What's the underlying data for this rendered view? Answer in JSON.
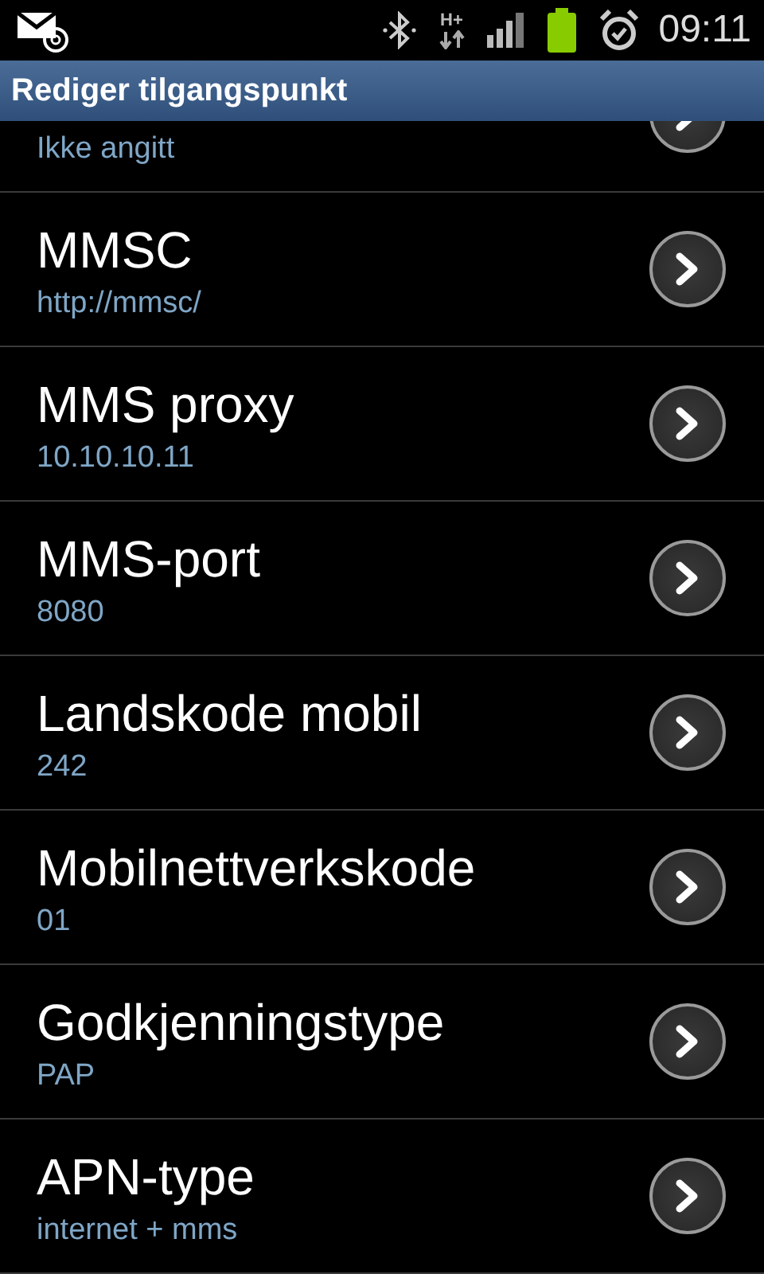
{
  "status_bar": {
    "network_label": "H+",
    "time": "09:11"
  },
  "title_bar": {
    "title": "Rediger tilgangspunkt"
  },
  "settings": [
    {
      "summary": "Ikke angitt"
    },
    {
      "title": "MMSC",
      "summary": "http://mmsc/"
    },
    {
      "title": "MMS proxy",
      "summary": "10.10.10.11"
    },
    {
      "title": "MMS-port",
      "summary": "8080"
    },
    {
      "title": "Landskode mobil",
      "summary": "242"
    },
    {
      "title": "Mobilnettverkskode",
      "summary": "01"
    },
    {
      "title": "Godkjenningstype",
      "summary": "PAP"
    },
    {
      "title": "APN-type",
      "summary": "internet + mms"
    }
  ]
}
